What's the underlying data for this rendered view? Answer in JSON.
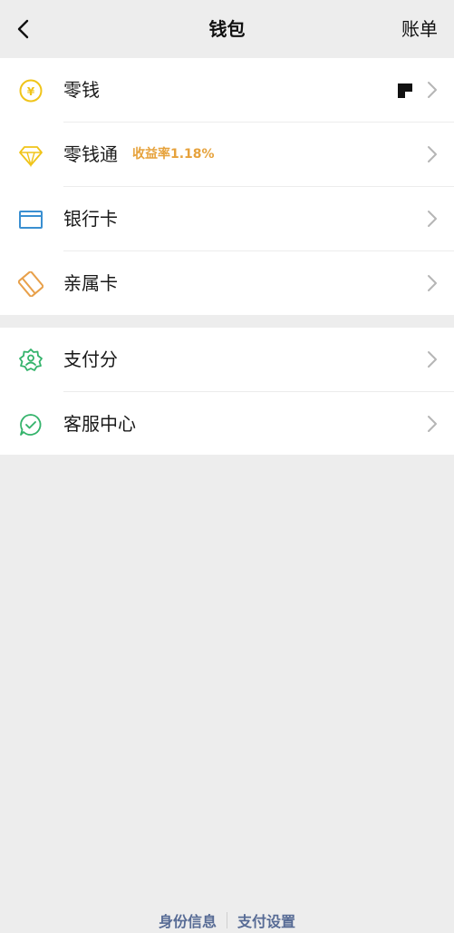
{
  "nav": {
    "title": "钱包",
    "right_label": "账单"
  },
  "wallet_items": [
    {
      "label": "零钱",
      "icon": "yuan-coin-icon"
    },
    {
      "label": "零钱通",
      "badge": "收益率1.18%",
      "icon": "diamond-icon"
    },
    {
      "label": "银行卡",
      "icon": "bank-card-icon"
    },
    {
      "label": "亲属卡",
      "icon": "family-card-icon"
    }
  ],
  "service_items": [
    {
      "label": "支付分",
      "icon": "pay-score-icon"
    },
    {
      "label": "客服中心",
      "icon": "customer-service-icon"
    }
  ],
  "footer": {
    "identity": "身份信息",
    "settings": "支付设置"
  },
  "colors": {
    "yellow": "#f0c419",
    "blue": "#3a8fd1",
    "orange": "#e8a04a",
    "green": "#34b36b",
    "link": "#576b95"
  }
}
